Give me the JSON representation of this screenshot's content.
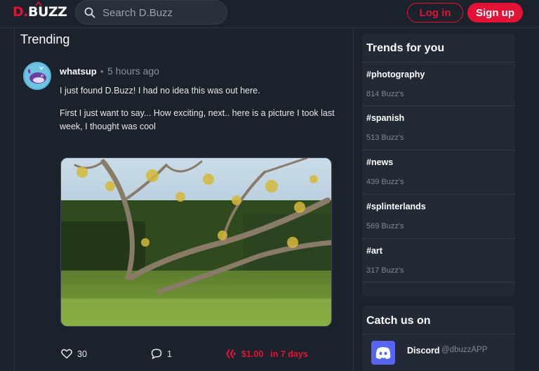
{
  "header": {
    "logo_prefix": "D.",
    "logo_suffix": "BUZZ",
    "search_placeholder": "Search D.Buzz",
    "login_label": "Log in",
    "signup_label": "Sign up",
    "brand_color": "#e31337"
  },
  "main": {
    "title": "Trending",
    "post": {
      "author": "whatsup",
      "separator": "•",
      "time": "5 hours ago",
      "paragraph_1": "I just found D.Buzz! I had no idea this was out here.",
      "paragraph_2": "First I just want to say... How exciting, next.. here is a picture I took last week, I thought was cool",
      "image_icon": "landscape-photo",
      "likes": "30",
      "comments": "1",
      "payout": "$1.00",
      "payout_time": "in 7 days"
    }
  },
  "sidebar": {
    "trends_title": "Trends for you",
    "trends": [
      {
        "tag": "#photography",
        "count": "814 Buzz's"
      },
      {
        "tag": "#spanish",
        "count": "513 Buzz's"
      },
      {
        "tag": "#news",
        "count": "439 Buzz's"
      },
      {
        "tag": "#splinterlands",
        "count": "569 Buzz's"
      },
      {
        "tag": "#art",
        "count": "317 Buzz's"
      }
    ],
    "catch_title": "Catch us on",
    "discord_name": "Discord",
    "discord_handle": "@dbuzzAPP"
  },
  "icons": {
    "search": "search-icon",
    "heart": "heart-icon",
    "comment": "comment-icon",
    "hive": "hive-icon",
    "discord": "discord-icon"
  }
}
